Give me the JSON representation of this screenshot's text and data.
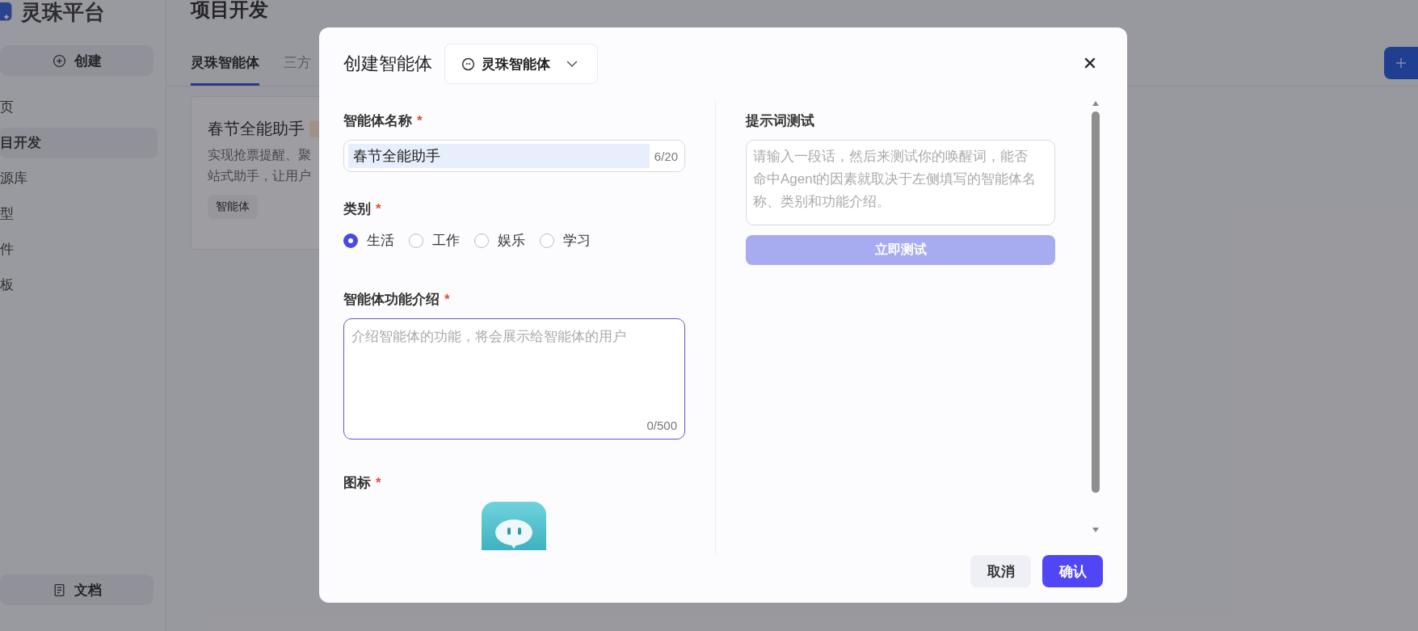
{
  "sidebar": {
    "logo": "灵珠平台",
    "create_button": "创建",
    "items": [
      {
        "label": "页",
        "selected": false
      },
      {
        "label": "目开发",
        "selected": true
      },
      {
        "label": "源库",
        "selected": false
      },
      {
        "label": "型",
        "selected": false
      },
      {
        "label": "件",
        "selected": false
      },
      {
        "label": "板",
        "selected": false
      }
    ],
    "docs_button": "文档"
  },
  "page": {
    "title": "项目开发",
    "tabs": [
      {
        "label": "灵珠智能体",
        "selected": true
      },
      {
        "label": "三方",
        "selected": false
      }
    ],
    "card": {
      "title": "春节全能助手",
      "description_lines": [
        "实现抢票提醒、聚",
        "站式助手，让用户"
      ],
      "tag": "智能体"
    }
  },
  "dialog": {
    "title": "创建智能体",
    "type_selector": "灵珠智能体",
    "name_field": {
      "label": "智能体名称",
      "required_mark": "*",
      "value": "春节全能助手",
      "counter": "6/20"
    },
    "category": {
      "label": "类别",
      "required_mark": "*",
      "options": [
        {
          "label": "生活",
          "selected": true
        },
        {
          "label": "工作",
          "selected": false
        },
        {
          "label": "娱乐",
          "selected": false
        },
        {
          "label": "学习",
          "selected": false
        }
      ]
    },
    "description_field": {
      "label": "智能体功能介绍",
      "required_mark": "*",
      "placeholder": "介绍智能体的功能，将会展示给智能体的用户",
      "counter": "0/500"
    },
    "icon_field": {
      "label": "图标",
      "required_mark": "*"
    },
    "prompt_test": {
      "title": "提示词测试",
      "placeholder": "请输入一段话，然后来测试你的唤醒词，能否命中Agent的因素就取决于左侧填写的智能体名称、类别和功能介绍。",
      "button": {
        "label": "立即测试",
        "disabled": true
      }
    },
    "buttons": [
      {
        "label": "取消",
        "kind": "secondary"
      },
      {
        "label": "确认",
        "kind": "primary"
      }
    ]
  }
}
